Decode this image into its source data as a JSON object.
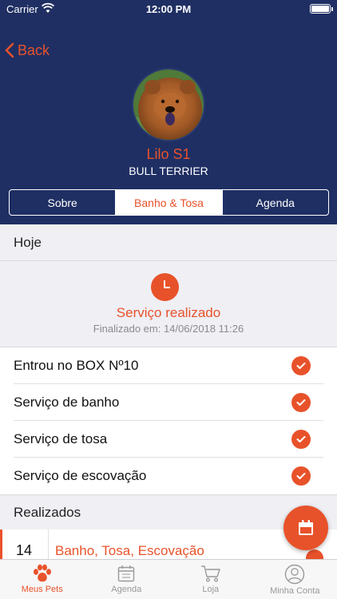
{
  "status_bar": {
    "carrier": "Carrier",
    "time": "12:00 PM"
  },
  "nav": {
    "back_label": "Back"
  },
  "pet": {
    "name": "Lilo S1",
    "breed": "BULL TERRIER"
  },
  "segments": [
    {
      "label": "Sobre",
      "active": false
    },
    {
      "label": "Banho & Tosa",
      "active": true
    },
    {
      "label": "Agenda",
      "active": false
    }
  ],
  "today": {
    "section_title": "Hoje",
    "status_title": "Serviço realizado",
    "status_subtitle": "Finalizado em: 14/06/2018 11:26",
    "checklist": [
      {
        "label": "Entrou no BOX Nº10",
        "done": true
      },
      {
        "label": "Serviço de banho",
        "done": true
      },
      {
        "label": "Serviço de tosa",
        "done": true
      },
      {
        "label": "Serviço de escovação",
        "done": true
      }
    ]
  },
  "history": {
    "section_title": "Realizados",
    "items": [
      {
        "day": "14",
        "description": "Banho, Tosa, Escovação"
      }
    ]
  },
  "tabbar": [
    {
      "label": "Meus Pets",
      "icon": "paw-icon",
      "active": true
    },
    {
      "label": "Agenda",
      "icon": "calendar-icon",
      "active": false
    },
    {
      "label": "Loja",
      "icon": "cart-icon",
      "active": false
    },
    {
      "label": "Minha Conta",
      "icon": "user-icon",
      "active": false
    }
  ],
  "colors": {
    "accent": "#e8522a",
    "header_bg": "#1f2f63",
    "page_bg": "#efeff4"
  }
}
